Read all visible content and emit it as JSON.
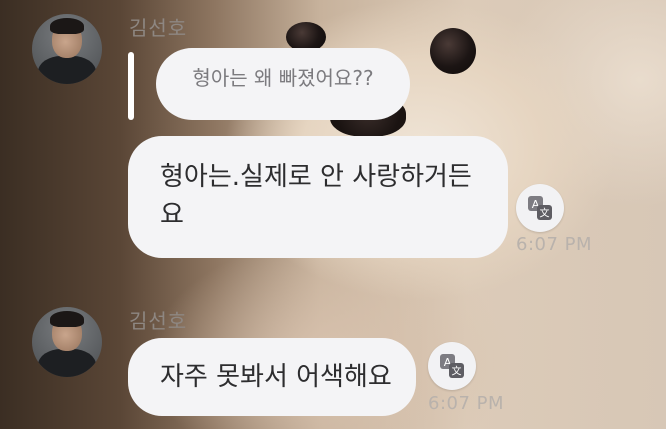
{
  "background": {
    "description_icon": "dog-photo-background"
  },
  "messages": [
    {
      "sender": "김선호",
      "reply_to": "형아는 왜 빠졌어요??",
      "text_line1": "형아는.실제로 안 사랑하거든",
      "text_line2": "요",
      "time": "6:07 PM"
    },
    {
      "sender": "김선호",
      "text": "자주 못봐서 어색해요",
      "time": "6:07 PM"
    }
  ],
  "icons": {
    "translate": "translate-icon",
    "avatar": "avatar"
  },
  "colors": {
    "bubble": "#f4f4f6",
    "text": "#2d2d2f",
    "timestamp": "#b9b2ac",
    "sender": "#8e8782"
  }
}
